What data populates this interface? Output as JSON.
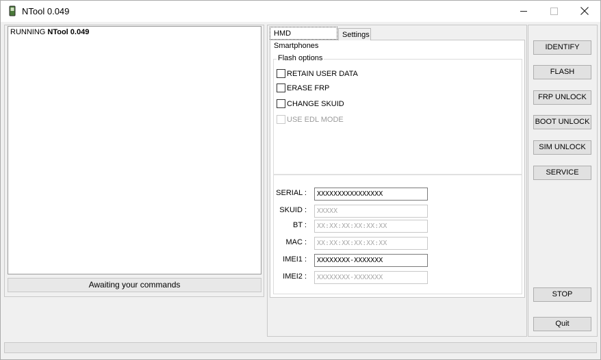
{
  "window": {
    "title": "NTool 0.049",
    "min_icon": "minimize-icon",
    "max_icon": "maximize-icon",
    "close_icon": "close-icon"
  },
  "log": {
    "prefix": "RUNNING ",
    "app": "NTool 0.049",
    "status": "Awaiting your commands"
  },
  "tabs": [
    {
      "label": "HMD Smartphones",
      "active": true
    },
    {
      "label": "Settings",
      "active": false
    }
  ],
  "flash_options": {
    "legend": "Flash options",
    "items": [
      {
        "label": "RETAIN USER DATA",
        "checked": false,
        "enabled": true
      },
      {
        "label": "ERASE FRP",
        "checked": false,
        "enabled": true
      },
      {
        "label": "CHANGE SKUID",
        "checked": false,
        "enabled": true
      },
      {
        "label": "USE EDL MODE",
        "checked": false,
        "enabled": false
      }
    ]
  },
  "fields": [
    {
      "label": "SERIAL :",
      "value": "XXXXXXXXXXXXXXXX"
    },
    {
      "label": "SKUID :",
      "value": "XXXXX"
    },
    {
      "label": "BT :",
      "value": "XX:XX:XX:XX:XX:XX"
    },
    {
      "label": "MAC :",
      "value": "XX:XX:XX:XX:XX:XX"
    },
    {
      "label": "IMEI1 :",
      "value": "XXXXXXXX-XXXXXXX"
    },
    {
      "label": "IMEI2 :",
      "value": "XXXXXXXX-XXXXXXX"
    }
  ],
  "buttons": {
    "identify": "IDENTIFY",
    "flash": "FLASH",
    "frp_unlock": "FRP UNLOCK",
    "boot_unlock": "BOOT UNLOCK",
    "sim_unlock": "SIM UNLOCK",
    "service": "SERVICE",
    "stop": "STOP",
    "quit": "Quit"
  }
}
